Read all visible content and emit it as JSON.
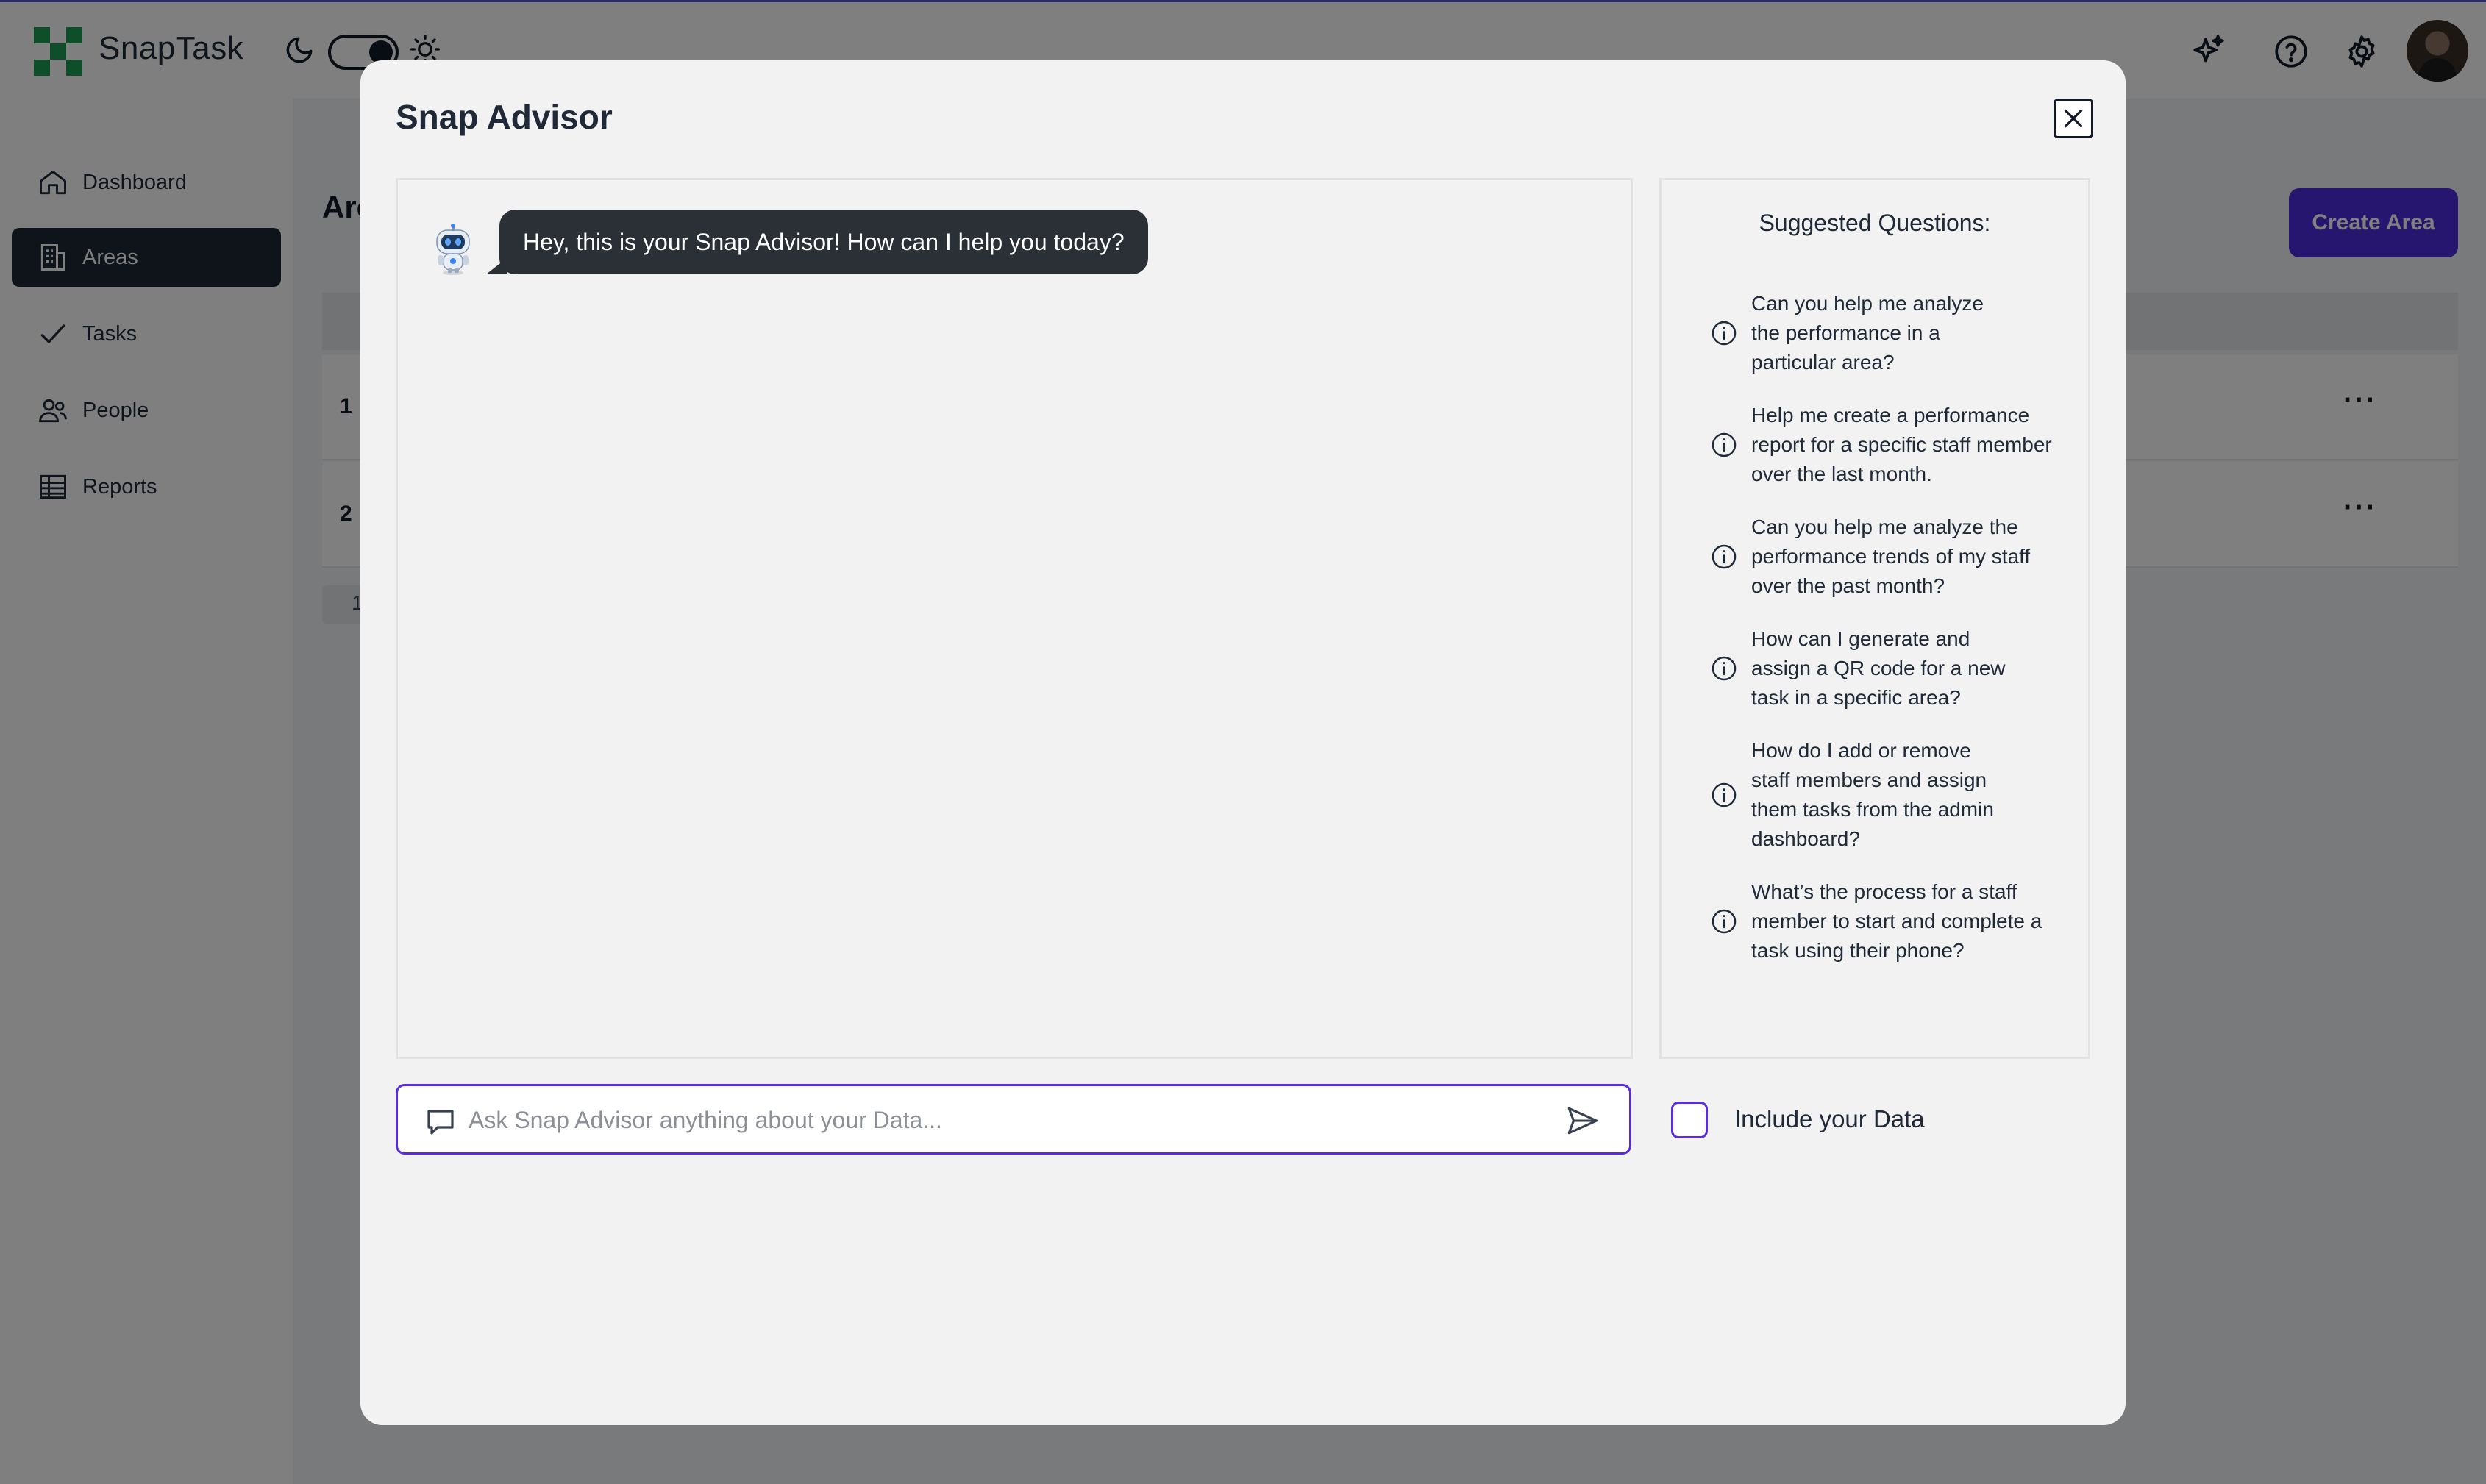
{
  "app": {
    "name": "SnapTask"
  },
  "sidebar": {
    "items": [
      {
        "label": "Dashboard",
        "icon": "home-icon"
      },
      {
        "label": "Areas",
        "icon": "building-icon",
        "active": true
      },
      {
        "label": "Tasks",
        "icon": "check-icon"
      },
      {
        "label": "People",
        "icon": "people-icon"
      },
      {
        "label": "Reports",
        "icon": "table-icon"
      }
    ]
  },
  "page": {
    "title": "Are",
    "create_button": "Create Area",
    "rows": [
      {
        "num": "1",
        "more": "···"
      },
      {
        "num": "2",
        "more": "···"
      }
    ],
    "pager": "1"
  },
  "modal": {
    "title": "Snap Advisor",
    "close_icon": "close-icon",
    "bot_message": "Hey, this is your Snap Advisor! How can I help you today?",
    "suggestions_title": "Suggested Questions:",
    "suggestions": [
      "Can you help me analyze the performance in a particular area?",
      "Help me create a performance report for a specific staff member over the last month.",
      "Can you help me analyze the performance trends of my staff over the past month?",
      "How can I generate and assign a QR code for a new task in a specific area?",
      "How do I add or remove staff members and assign them tasks from the admin dashboard?",
      "What’s the process for a staff member to start and complete a task using their phone?"
    ],
    "input_placeholder": "Ask Snap Advisor anything about your Data...",
    "include_label": "Include your Data",
    "include_checked": false
  },
  "colors": {
    "accent": "#4f2ce0",
    "sidebar_active": "#1f2937",
    "bubble": "#2b2f36"
  }
}
